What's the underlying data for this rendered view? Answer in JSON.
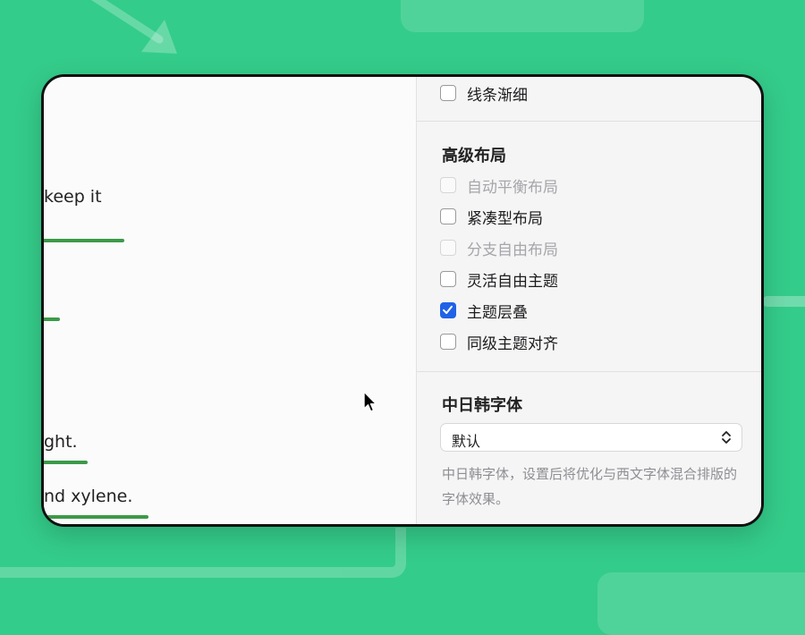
{
  "editor": {
    "lines": [
      "keep it",
      "ght.",
      "nd xylene."
    ]
  },
  "settings": {
    "top_option": {
      "label": "线条渐细",
      "checked": false,
      "disabled": false
    },
    "advanced_layout": {
      "title": "高级布局",
      "options": [
        {
          "label": "自动平衡布局",
          "checked": false,
          "disabled": true
        },
        {
          "label": "紧凑型布局",
          "checked": false,
          "disabled": false
        },
        {
          "label": "分支自由布局",
          "checked": false,
          "disabled": true
        },
        {
          "label": "灵活自由主题",
          "checked": false,
          "disabled": false
        },
        {
          "label": "主题层叠",
          "checked": true,
          "disabled": false
        },
        {
          "label": "同级主题对齐",
          "checked": false,
          "disabled": false
        }
      ]
    },
    "cjk_font": {
      "title": "中日韩字体",
      "selected": "默认",
      "help": "中日韩字体，设置后将优化与西文字体混合排版的字体效果。"
    }
  },
  "colors": {
    "background": "#34cc8a",
    "accent": "#1f62e6",
    "underline": "#3c9a48"
  },
  "icons": {
    "cursor": "mouse-pointer-icon",
    "select": "chevron-updown-icon",
    "check": "checkmark-icon"
  }
}
